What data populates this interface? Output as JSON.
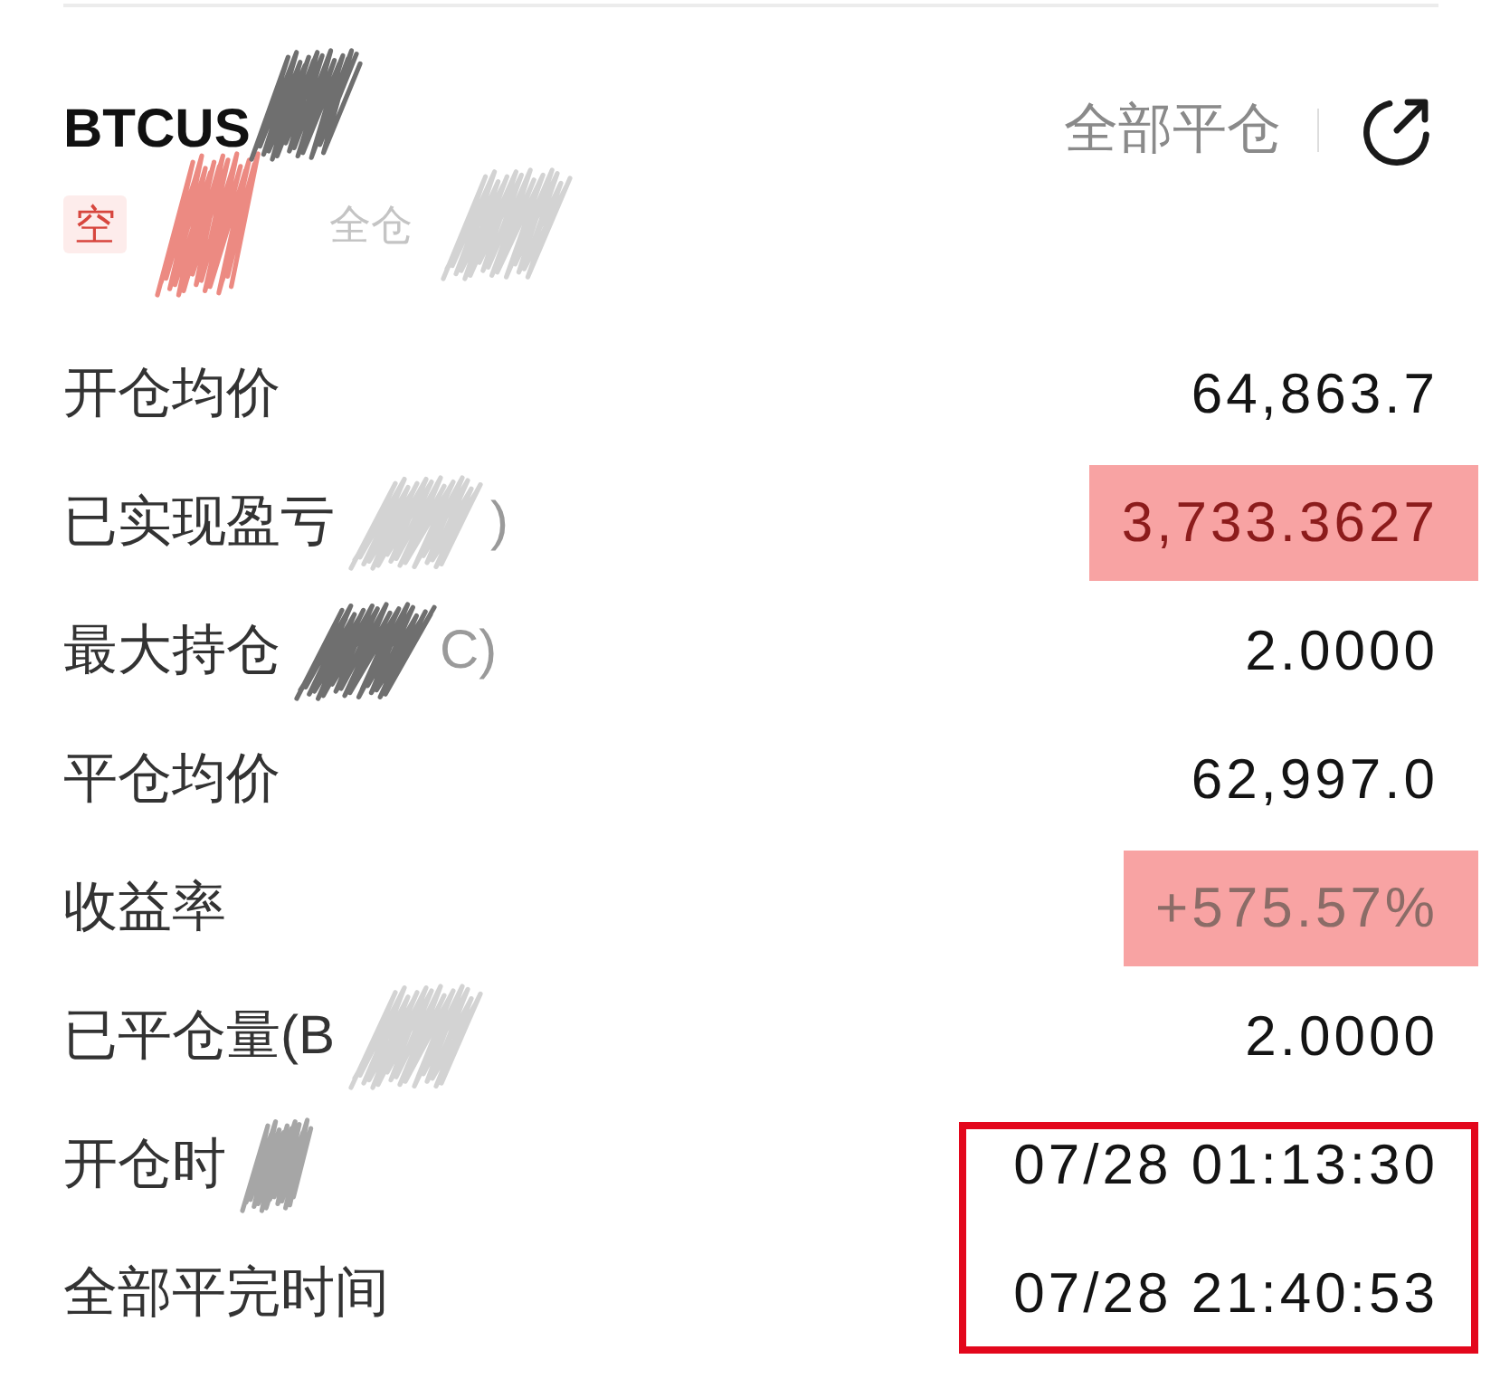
{
  "header": {
    "symbol": "BTCUS",
    "scribble": {
      "color": "#6f6f6f"
    },
    "close_all_button": "全部平仓"
  },
  "tags": [
    {
      "label": "空",
      "kind": "side",
      "scribble": {
        "color": "#ec8a82"
      }
    },
    {
      "label": "全仓",
      "kind": "mode",
      "scribble": {
        "color": "#d3d3d3"
      }
    }
  ],
  "rows": [
    {
      "label": "开仓均价",
      "value": "64,863.7",
      "highlighted": false,
      "boxed": false
    },
    {
      "label": "已实现盈亏",
      "scribble": {
        "color": "#d3d3d3"
      },
      "label_tail": ")",
      "value": "3,733.3627",
      "highlighted": true,
      "color": "#8c1c1c",
      "boxed": false
    },
    {
      "label": "最大持仓",
      "scribble": {
        "color": "#6f6f6f"
      },
      "label_tail": "C)",
      "value": "2.0000",
      "highlighted": false,
      "boxed": false
    },
    {
      "label": "平仓均价",
      "value": "62,997.0",
      "highlighted": false,
      "boxed": false
    },
    {
      "label": "收益率",
      "value": "+575.57%",
      "highlighted": true,
      "color": "#8b6c67",
      "boxed": false
    },
    {
      "label": "已平仓量(B",
      "scribble": {
        "color": "#d3d3d3"
      },
      "value": "2.0000",
      "highlighted": false,
      "boxed": false
    },
    {
      "label": "开仓时",
      "scribble": {
        "color": "#a6a6a6"
      },
      "value": "07/28 01:13:30",
      "highlighted": false,
      "boxed": true
    },
    {
      "label": "全部平完时间",
      "value": "07/28 21:40:53",
      "highlighted": false,
      "boxed": true
    }
  ]
}
